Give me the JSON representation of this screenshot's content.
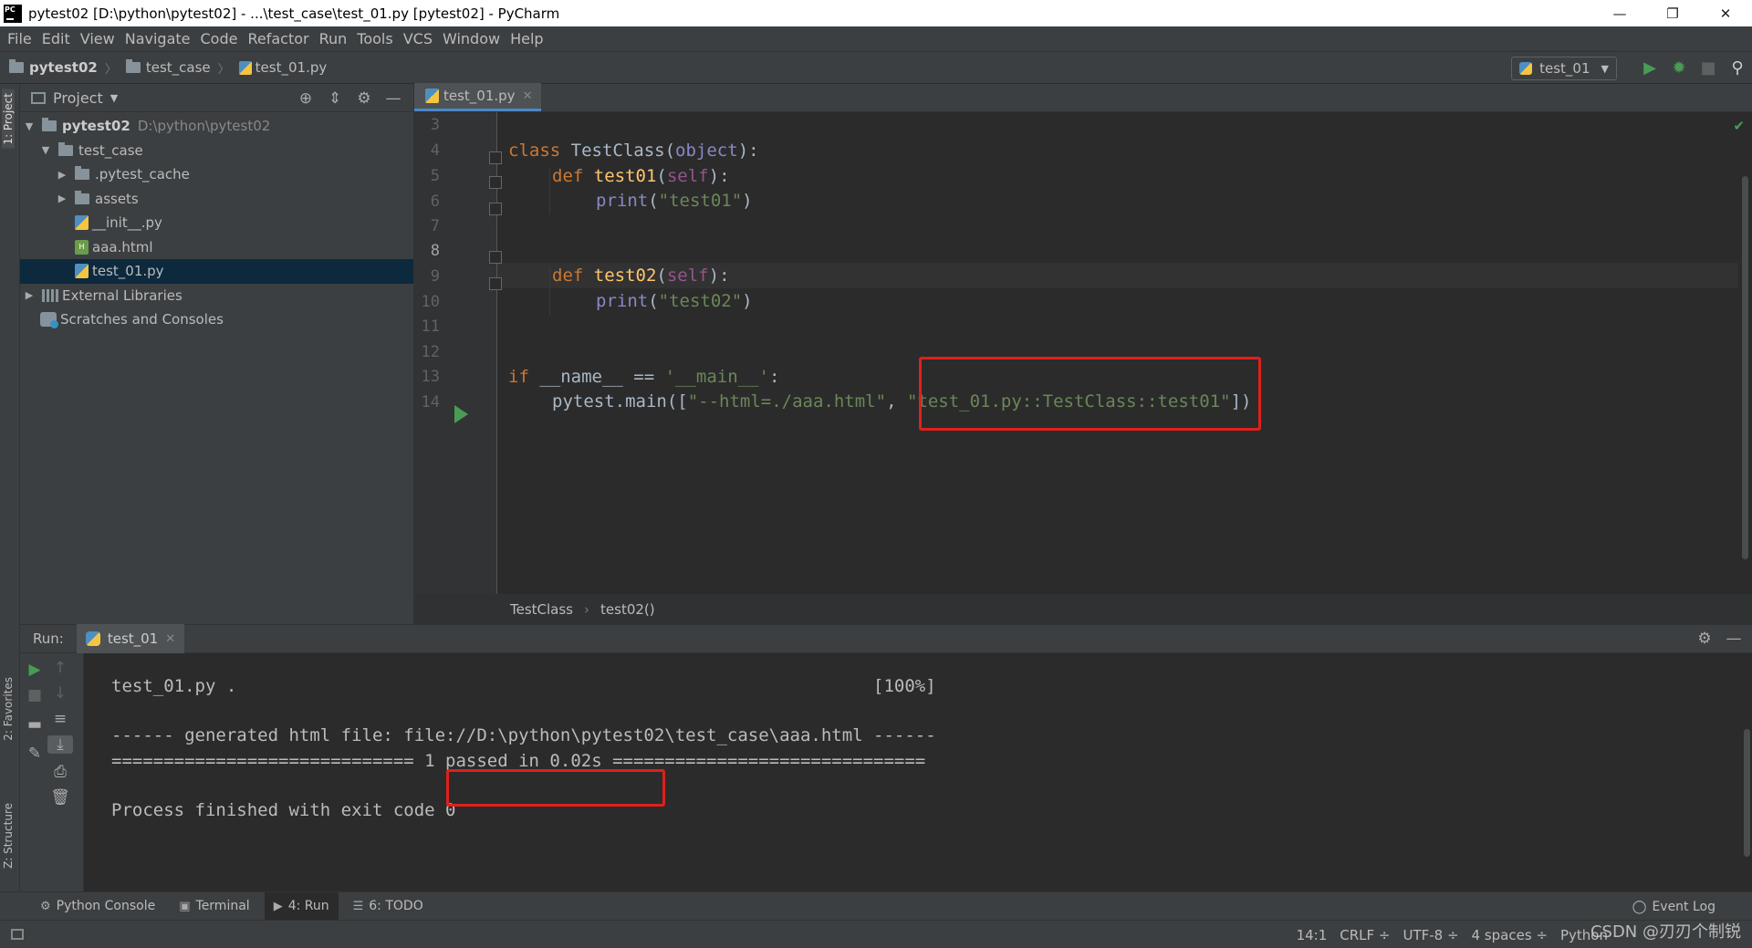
{
  "window": {
    "title": "pytest02 [D:\\python\\pytest02] - ...\\test_case\\test_01.py [pytest02] - PyCharm",
    "minimize": "—",
    "restore": "❐",
    "close": "✕"
  },
  "menu": [
    "File",
    "Edit",
    "View",
    "Navigate",
    "Code",
    "Refactor",
    "Run",
    "Tools",
    "VCS",
    "Window",
    "Help"
  ],
  "navbar": {
    "crumbs": [
      "pytest02",
      "test_case",
      "test_01.py"
    ],
    "run_config": "test_01"
  },
  "left_strip": {
    "project": "1: Project",
    "favorites": "2: Favorites",
    "structure": "Z: Structure"
  },
  "project_panel": {
    "title": "Project",
    "tree": [
      {
        "label": "pytest02",
        "path": "D:\\python\\pytest02"
      },
      {
        "label": "test_case"
      },
      {
        "label": ".pytest_cache"
      },
      {
        "label": "assets"
      },
      {
        "label": "__init__.py"
      },
      {
        "label": "aaa.html"
      },
      {
        "label": "test_01.py"
      },
      {
        "label": "External Libraries"
      },
      {
        "label": "Scratches and Consoles"
      }
    ]
  },
  "editor": {
    "tab": "test_01.py",
    "line_numbers": [
      "3",
      "4",
      "5",
      "6",
      "7",
      "8",
      "9",
      "10",
      "11",
      "12",
      "13",
      "14"
    ],
    "code": {
      "l4_kw": "class",
      "l4_name": " TestClass",
      "l4_p1": "(",
      "l4_base": "object",
      "l4_p2": "):",
      "l5_kw": "def",
      "l5_name": " test01",
      "l5_p1": "(",
      "l5_self": "self",
      "l5_p2": "):",
      "l6_fn": "print",
      "l6_p1": "(",
      "l6_str": "\"test01\"",
      "l6_p2": ")",
      "l8_kw": "def",
      "l8_name": " test02",
      "l8_p1": "(",
      "l8_self": "self",
      "l8_p2": "):",
      "l9_fn": "print",
      "l9_p1": "(",
      "l9_str": "\"test02\"",
      "l9_p2": ")",
      "l12_kw": "if",
      "l12_a": " __name__ == ",
      "l12_str": "'__main__'",
      "l12_b": ":",
      "l13_a": "pytest.main([",
      "l13_s1": "\"--html=./aaa.html\"",
      "l13_b": ", ",
      "l13_s2": "\"test_01.py::TestClass::test01\"",
      "l13_c": "])"
    },
    "breadcrumb": [
      "TestClass",
      "test02()"
    ]
  },
  "run_panel": {
    "label": "Run:",
    "tab": "test_01",
    "console": {
      "line1": "test_01.py .                                                             [100%]",
      "line2": "------ generated html file: file://D:\\python\\pytest02\\test_case\\aaa.html ------",
      "line3": "============================= 1 passed in 0.02s ==============================",
      "line4": "Process finished with exit code 0"
    }
  },
  "bottom_tabs": {
    "python_console": "Python Console",
    "terminal": "Terminal",
    "run": "4: Run",
    "todo": "6: TODO",
    "event_log": "Event Log"
  },
  "status": {
    "position": "14:1",
    "line_sep": "CRLF ÷",
    "encoding": "UTF-8 ÷",
    "indent": "4 spaces ÷",
    "interpreter": "Python"
  },
  "watermark": "CSDN @刃刃个制锐",
  "icons": {
    "add-config": "target-icon",
    "collapse": "collapse-icon",
    "settings": "gear-icon",
    "hide": "minimize-icon",
    "run": "run-icon",
    "debug": "debug-icon",
    "stop": "stop-icon",
    "search": "search-icon"
  }
}
